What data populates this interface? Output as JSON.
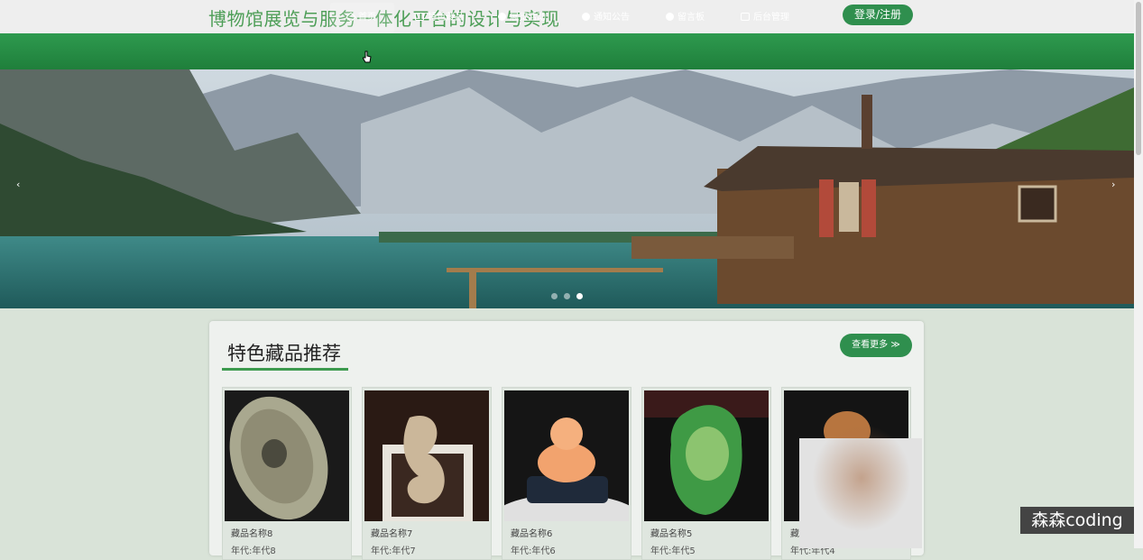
{
  "header": {
    "site_title": "博物馆展览与服务一体化平台的设计与实现",
    "login_label": "登录/注册"
  },
  "nav": {
    "items": [
      {
        "label": "首页",
        "icon": "star-icon",
        "active": true
      },
      {
        "label": "特色藏品",
        "icon": "bag-icon",
        "active": false
      },
      {
        "label": "展览活动",
        "icon": "clock-icon",
        "active": false
      },
      {
        "label": "通知公告",
        "icon": "info-icon",
        "active": false
      },
      {
        "label": "留言板",
        "icon": "info-icon",
        "active": false
      },
      {
        "label": "后台管理",
        "icon": "lock-icon",
        "active": false
      }
    ]
  },
  "carousel": {
    "prev": "‹",
    "next": "›",
    "slide_count": 3,
    "active_slide": 3
  },
  "featured": {
    "title": "特色藏品推荐",
    "more_label": "查看更多 ≫",
    "items": [
      {
        "name": "藏品名称8",
        "era": "年代:年代8"
      },
      {
        "name": "藏品名称7",
        "era": "年代:年代7"
      },
      {
        "name": "藏品名称6",
        "era": "年代:年代6"
      },
      {
        "name": "藏品名称5",
        "era": "年代:年代5"
      },
      {
        "name": "藏品名称4",
        "era": "年代:年代4"
      }
    ]
  },
  "watermark": "森森coding",
  "colors": {
    "brand_green": "#2f8f4e",
    "title_green": "#4d9e57",
    "nav_green": "#2e9a4f"
  }
}
